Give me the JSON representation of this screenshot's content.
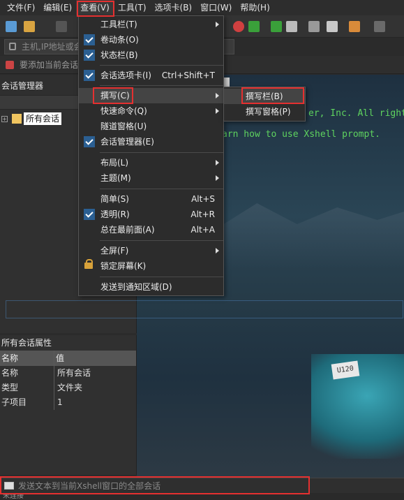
{
  "menubar": {
    "items": [
      "文件(F)",
      "编辑(E)",
      "查看(V)",
      "工具(T)",
      "选项卡(B)",
      "窗口(W)",
      "帮助(H)"
    ]
  },
  "toolbar": {
    "address_placeholder": "主机,IP地址或会话名称",
    "hint": "要添加当前会话,点击左侧的箭头按钮。"
  },
  "session_manager": {
    "title": "会话管理器",
    "tree_root": "所有会话"
  },
  "properties": {
    "title": "所有会话属性",
    "headers": [
      "名称",
      "值"
    ],
    "rows": [
      [
        "名称",
        "所有会话"
      ],
      [
        "类型",
        "文件夹"
      ],
      [
        "子项目",
        "1"
      ]
    ]
  },
  "terminal": {
    "line1": "er, Inc. All rights",
    "line2": "arn how to use Xshell prompt.",
    "plate": "U120"
  },
  "view_menu": {
    "items": [
      {
        "label": "工具栏(T)",
        "shortcut": "",
        "submenu": true,
        "checked": false
      },
      {
        "label": "卷动条(O)",
        "shortcut": "",
        "submenu": false,
        "checked": true
      },
      {
        "label": "状态栏(B)",
        "shortcut": "",
        "submenu": false,
        "checked": true
      },
      {
        "label": "会话选项卡(I)",
        "shortcut": "Ctrl+Shift+T",
        "submenu": false,
        "checked": true
      },
      {
        "label": "撰写(C)",
        "shortcut": "",
        "submenu": true,
        "checked": false
      },
      {
        "label": "快速命令(Q)",
        "shortcut": "",
        "submenu": true,
        "checked": false
      },
      {
        "label": "隧道窗格(U)",
        "shortcut": "",
        "submenu": false,
        "checked": false
      },
      {
        "label": "会话管理器(E)",
        "shortcut": "",
        "submenu": false,
        "checked": true
      },
      {
        "label": "布局(L)",
        "shortcut": "",
        "submenu": true,
        "checked": false
      },
      {
        "label": "主题(M)",
        "shortcut": "",
        "submenu": true,
        "checked": false
      },
      {
        "label": "简单(S)",
        "shortcut": "Alt+S",
        "submenu": false,
        "checked": false
      },
      {
        "label": "透明(R)",
        "shortcut": "Alt+R",
        "submenu": false,
        "checked": true
      },
      {
        "label": "总在最前面(A)",
        "shortcut": "Alt+A",
        "submenu": false,
        "checked": false
      },
      {
        "label": "全屏(F)",
        "shortcut": "",
        "submenu": true,
        "checked": false
      },
      {
        "label": "锁定屏幕(K)",
        "shortcut": "",
        "submenu": false,
        "checked": false
      },
      {
        "label": "发送到通知区域(D)",
        "shortcut": "",
        "submenu": false,
        "checked": false
      }
    ]
  },
  "compose_submenu": {
    "items": [
      "撰写栏(B)",
      "撰写窗格(P)"
    ]
  },
  "compose_bar": {
    "text": "发送文本到当前Xshell窗口的全部会话"
  },
  "statusbar": {
    "text": "未连接"
  },
  "colors": {
    "highlight_box": "#e53030",
    "check_bg": "#2b5f92",
    "terminal_text": "#5fd35f"
  }
}
